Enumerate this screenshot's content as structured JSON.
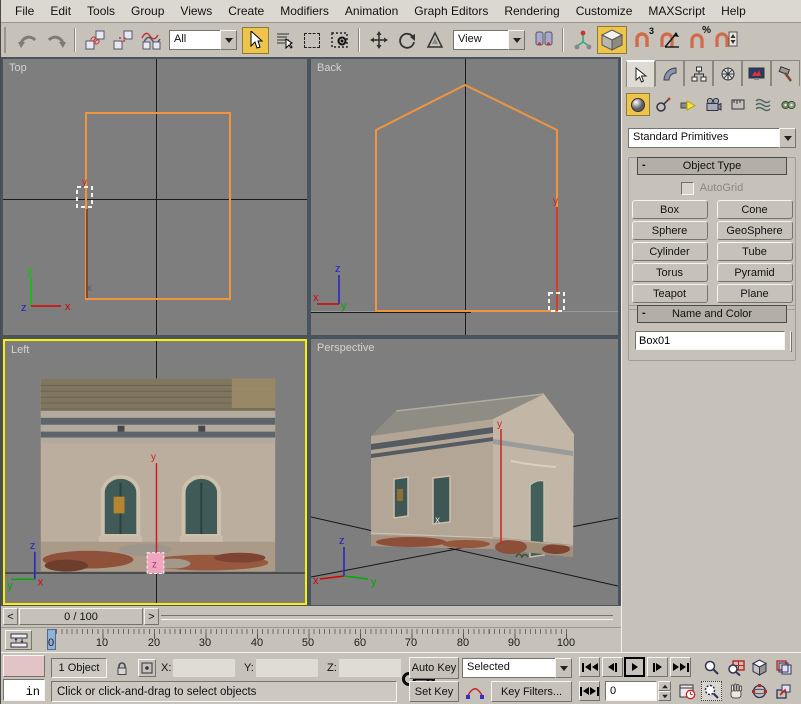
{
  "menu": {
    "items": [
      "File",
      "Edit",
      "Tools",
      "Group",
      "Views",
      "Create",
      "Modifiers",
      "Animation",
      "Graph Editors",
      "Rendering",
      "Customize",
      "MAXScript",
      "Help"
    ]
  },
  "toolbar": {
    "selection_filter": "All",
    "reference_coordsys": "View",
    "snap_count_label": "3",
    "snap_percent_label": "%",
    "icons": [
      "undo",
      "redo",
      "select-and-link",
      "unlink-selection",
      "bind-to-space-warp",
      "select-object",
      "select-by-name",
      "rectangular-selection-region",
      "window-crossing-toggle",
      "select-and-move",
      "select-and-rotate",
      "select-and-scale",
      "use-pivot-point-center",
      "select-and-manipulate",
      "snaps-toggle-3d",
      "angle-snap-toggle",
      "percent-snap-toggle",
      "spinner-snap-toggle"
    ]
  },
  "viewports": {
    "top_label": "Top",
    "back_label": "Back",
    "left_label": "Left",
    "persp_label": "Perspective",
    "axis": {
      "x": "x",
      "y": "y",
      "z": "z"
    },
    "wireframe_color": "#ef9540",
    "active_border_color": "#f8ee12",
    "background_color": "#7e7e7e"
  },
  "command_panel": {
    "category_dropdown": "Standard Primitives",
    "rollout_collapse": "-",
    "object_type_title": "Object Type",
    "autogrid_label": "AutoGrid",
    "object_buttons": [
      "Box",
      "Cone",
      "Sphere",
      "GeoSphere",
      "Cylinder",
      "Tube",
      "Torus",
      "Pyramid",
      "Teapot",
      "Plane"
    ],
    "name_color_title": "Name and Color",
    "object_name": "Box01",
    "object_color": "#e79ab6",
    "tab_icons": [
      "create-tab",
      "modify-tab",
      "hierarchy-tab",
      "motion-tab",
      "display-tab",
      "utilities-tab"
    ],
    "category_icons": [
      "geometry",
      "shapes",
      "lights",
      "cameras",
      "helpers",
      "space-warps",
      "systems"
    ]
  },
  "timeline": {
    "slider_value": "0 / 100",
    "prev_arrow": "<",
    "next_arrow": ">",
    "ticks": [
      "0",
      "10",
      "20",
      "30",
      "40",
      "50",
      "60",
      "70",
      "80",
      "90",
      "100"
    ]
  },
  "status": {
    "selection_count": "1 Object",
    "x_label": "X:",
    "y_label": "Y:",
    "z_label": "Z:",
    "x_value": "",
    "y_value": "",
    "z_value": "",
    "prompt": "Click or click-and-drag to select objects",
    "listener_fragment": "in"
  },
  "animation": {
    "auto_key": "Auto Key",
    "set_key": "Set Key",
    "key_mode_dropdown": "Selected",
    "key_filters": "Key Filters...",
    "frame_field": "0"
  }
}
